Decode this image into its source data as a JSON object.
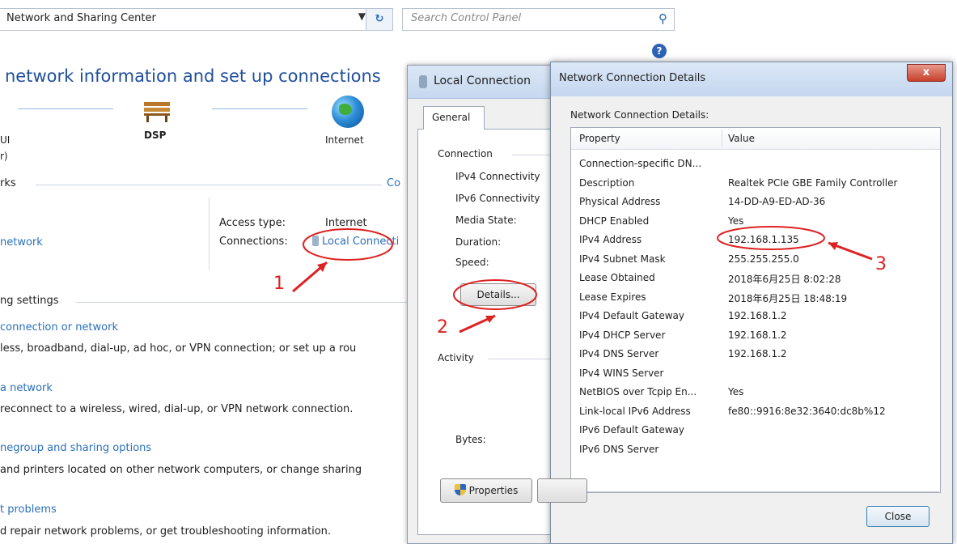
{
  "nsc": {
    "address": "Network and Sharing Center",
    "search_placeholder": "Search Control Panel",
    "heading": "network information and set up connections",
    "map": {
      "node_left": "UI",
      "node_left_sub": "r)",
      "node_mid": "DSP",
      "node_right": "Internet"
    },
    "networks_label": "rks",
    "customize_link": "Co",
    "access_type_label": "Access type:",
    "access_type_value": "Internet",
    "connections_label": "Connections:",
    "connection_link": "Local Connecti",
    "network_name": "network",
    "network_name_prefix": "",
    "settings_label": "ng settings",
    "tasks": [
      {
        "link": "connection or network",
        "desc": "less, broadband, dial-up, ad hoc, or VPN connection; or set up a rou"
      },
      {
        "link": "a network",
        "desc": "reconnect to a wireless, wired, dial-up, or VPN network connection."
      },
      {
        "link": "negroup and sharing options",
        "desc": "and printers located on other network computers, or change sharing"
      },
      {
        "link": "t problems",
        "desc": "d repair network problems, or get troubleshooting information."
      }
    ]
  },
  "lcs": {
    "title": "Local Connection",
    "tab": "General",
    "connection_group": "Connection",
    "fields": [
      "IPv4 Connectivity",
      "IPv6 Connectivity",
      "Media State:",
      "Duration:",
      "Speed:"
    ],
    "details_button": "Details...",
    "activity_group": "Activity",
    "bytes_label": "Bytes:",
    "properties_button": "Properties"
  },
  "ncd": {
    "title": "Network Connection Details",
    "caption": "Network Connection Details:",
    "col_property": "Property",
    "col_value": "Value",
    "rows": [
      {
        "p": "Connection-specific DN...",
        "v": ""
      },
      {
        "p": "Description",
        "v": "Realtek PCIe GBE Family Controller"
      },
      {
        "p": "Physical Address",
        "v": "14-DD-A9-ED-AD-36"
      },
      {
        "p": "DHCP Enabled",
        "v": "Yes"
      },
      {
        "p": "IPv4 Address",
        "v": "192.168.1.135"
      },
      {
        "p": "IPv4 Subnet Mask",
        "v": "255.255.255.0"
      },
      {
        "p": "Lease Obtained",
        "v": "2018年6月25日 8:02:28"
      },
      {
        "p": "Lease Expires",
        "v": "2018年6月25日 18:48:19"
      },
      {
        "p": "IPv4 Default Gateway",
        "v": "192.168.1.2"
      },
      {
        "p": "IPv4 DHCP Server",
        "v": "192.168.1.2"
      },
      {
        "p": "IPv4 DNS Server",
        "v": "192.168.1.2"
      },
      {
        "p": "IPv4 WINS Server",
        "v": ""
      },
      {
        "p": "NetBIOS over Tcpip En...",
        "v": "Yes"
      },
      {
        "p": "Link-local IPv6 Address",
        "v": "fe80::9916:8e32:3640:dc8b%12"
      },
      {
        "p": "IPv6 Default Gateway",
        "v": ""
      },
      {
        "p": "IPv6 DNS Server",
        "v": ""
      }
    ],
    "close_button": "Close",
    "close_x": "x"
  },
  "annotations": {
    "one": "1",
    "two": "2",
    "three": "3",
    "color": "#dd2222"
  }
}
